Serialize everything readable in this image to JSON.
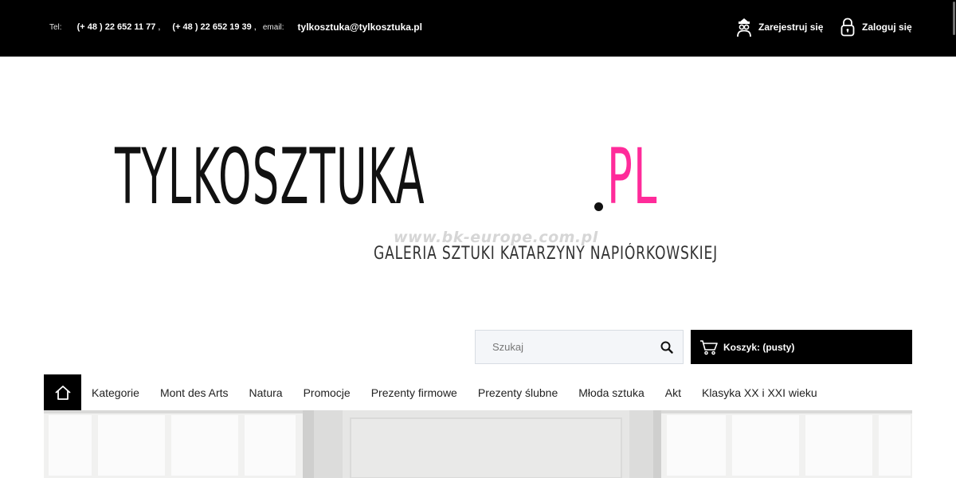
{
  "topbar": {
    "tel_label": "Tel:",
    "phone1": "(+ 48 ) 22 652 11 77",
    "phone2": "(+ 48 ) 22 652 19 39",
    "separator": ",",
    "email_label": "email:",
    "email": "tylkosztuka@tylkosztuka.pl",
    "register_label": "Zarejestruj się",
    "login_label": "Zaloguj się"
  },
  "logo": {
    "main": "TYLKOSZTUKA",
    "ext": "PL",
    "accent_color": "#ff2b9a",
    "tagline": "GALERIA SZTUKI KATARZYNY NAPIÓRKOWSKIEJ"
  },
  "watermark": "www.bk-europe.com.pl",
  "search": {
    "placeholder": "Szukaj"
  },
  "cart": {
    "label": "Koszyk: (pusty)"
  },
  "nav": {
    "items": [
      "Kategorie",
      "Mont des Arts",
      "Natura",
      "Promocje",
      "Prezenty firmowe",
      "Prezenty ślubne",
      "Młoda sztuka",
      "Akt",
      "Klasyka XX i XXI wieku"
    ]
  },
  "icons": {
    "register": "user-glasses-icon",
    "login": "padlock-icon",
    "search": "search-icon",
    "cart": "cart-icon",
    "home": "home-icon"
  }
}
